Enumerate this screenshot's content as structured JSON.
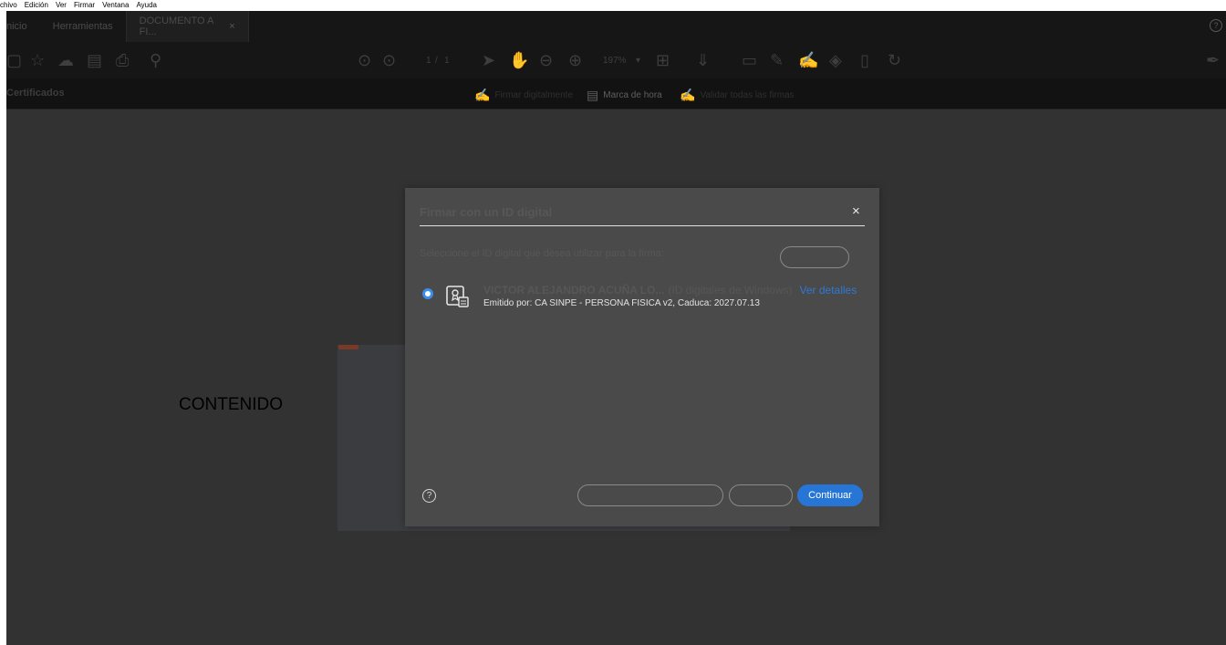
{
  "menu": [
    "chivo",
    "Edición",
    "Ver",
    "Firmar",
    "Ventana",
    "Ayuda"
  ],
  "tabs": {
    "home": "nicio",
    "tools": "Herramientas",
    "doc": "DOCUMENTO A FI...",
    "close": "×",
    "help": "?"
  },
  "toolbar": {
    "page_current": "1",
    "page_sep": "/",
    "page_total": "1",
    "zoom": "197%"
  },
  "subbar": {
    "title": "Certificados",
    "sign_digitally": "Firmar digitalmente",
    "timestamp": "Marca de hora",
    "validate_all": "Validar todas las firmas"
  },
  "document": {
    "content_text": "CONTENIDO"
  },
  "dialog": {
    "title": "Firmar con un ID digital",
    "close": "×",
    "instruction": "Seleccione el ID digital que desea utilizar para la firma:",
    "cert_name": "VICTOR ALEJANDRO ACUÑA LO...",
    "cert_type": "(ID digitales de Windows)",
    "details_link": "Ver detalles",
    "issuer": "Emitido por: CA SINPE - PERSONA FISICA v2, Caduca: 2027.07.13",
    "help": "?",
    "continue": "Continuar"
  },
  "colors": {
    "accent": "#2776d6",
    "dialog_bg": "#4a4a4a",
    "app_bg": "#323232"
  }
}
